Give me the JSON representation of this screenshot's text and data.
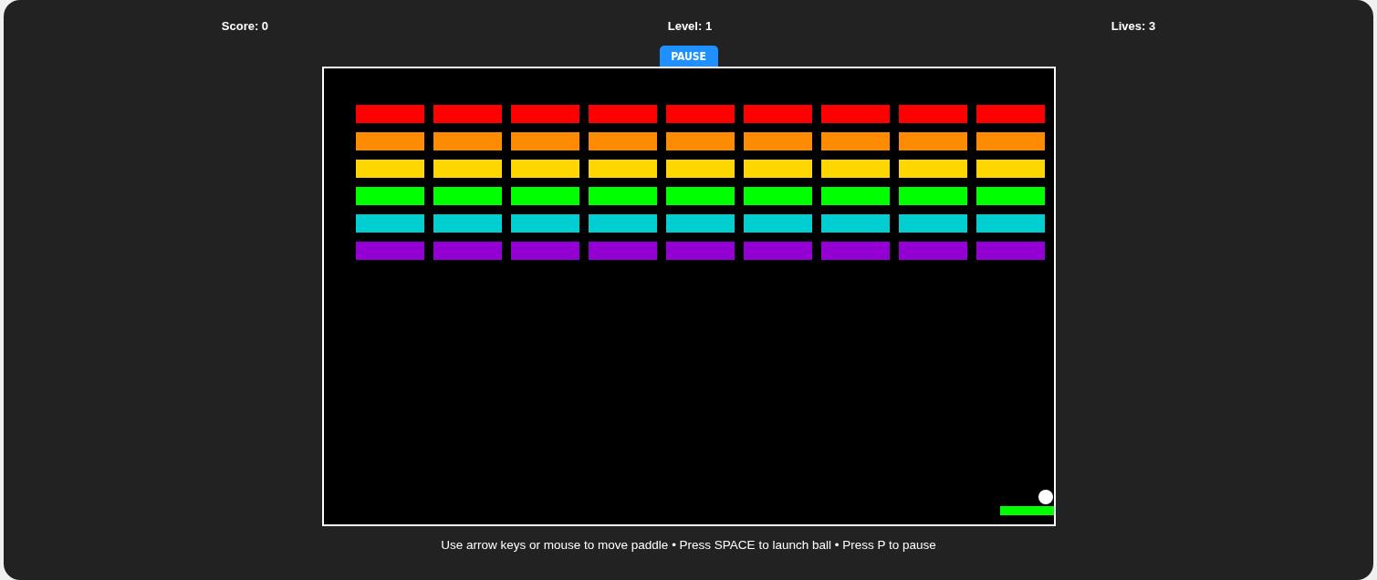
{
  "hud": {
    "score": "Score: 0",
    "level": "Level: 1",
    "lives": "Lives: 3"
  },
  "pause_button": {
    "label": "PAUSE"
  },
  "bricks": [
    {
      "color": "#ff0000",
      "bricks": [
        {
          "intact": true
        },
        {
          "intact": true
        },
        {
          "intact": true
        },
        {
          "intact": true
        },
        {
          "intact": true
        },
        {
          "intact": true
        },
        {
          "intact": true
        },
        {
          "intact": true
        },
        {
          "intact": true
        }
      ]
    },
    {
      "color": "#ff8c00",
      "bricks": [
        {
          "intact": true
        },
        {
          "intact": true
        },
        {
          "intact": true
        },
        {
          "intact": true
        },
        {
          "intact": true
        },
        {
          "intact": true
        },
        {
          "intact": true
        },
        {
          "intact": true
        },
        {
          "intact": true
        }
      ]
    },
    {
      "color": "#ffd700",
      "bricks": [
        {
          "intact": true
        },
        {
          "intact": true
        },
        {
          "intact": true
        },
        {
          "intact": true
        },
        {
          "intact": true
        },
        {
          "intact": true
        },
        {
          "intact": true
        },
        {
          "intact": true
        },
        {
          "intact": true
        }
      ]
    },
    {
      "color": "#00ff00",
      "bricks": [
        {
          "intact": true
        },
        {
          "intact": true
        },
        {
          "intact": true
        },
        {
          "intact": true
        },
        {
          "intact": true
        },
        {
          "intact": true
        },
        {
          "intact": true
        },
        {
          "intact": true
        },
        {
          "intact": true
        }
      ]
    },
    {
      "color": "#00ced1",
      "bricks": [
        {
          "intact": true
        },
        {
          "intact": true
        },
        {
          "intact": true
        },
        {
          "intact": true
        },
        {
          "intact": true
        },
        {
          "intact": true
        },
        {
          "intact": true
        },
        {
          "intact": true
        },
        {
          "intact": true
        }
      ]
    },
    {
      "color": "#9400d3",
      "bricks": [
        {
          "intact": true
        },
        {
          "intact": true
        },
        {
          "intact": true
        },
        {
          "intact": true
        },
        {
          "intact": true
        },
        {
          "intact": true
        },
        {
          "intact": true
        },
        {
          "intact": true
        },
        {
          "intact": true
        }
      ]
    }
  ],
  "instructions": "Use arrow keys or mouse to move paddle • Press SPACE to launch ball • Press P to pause"
}
